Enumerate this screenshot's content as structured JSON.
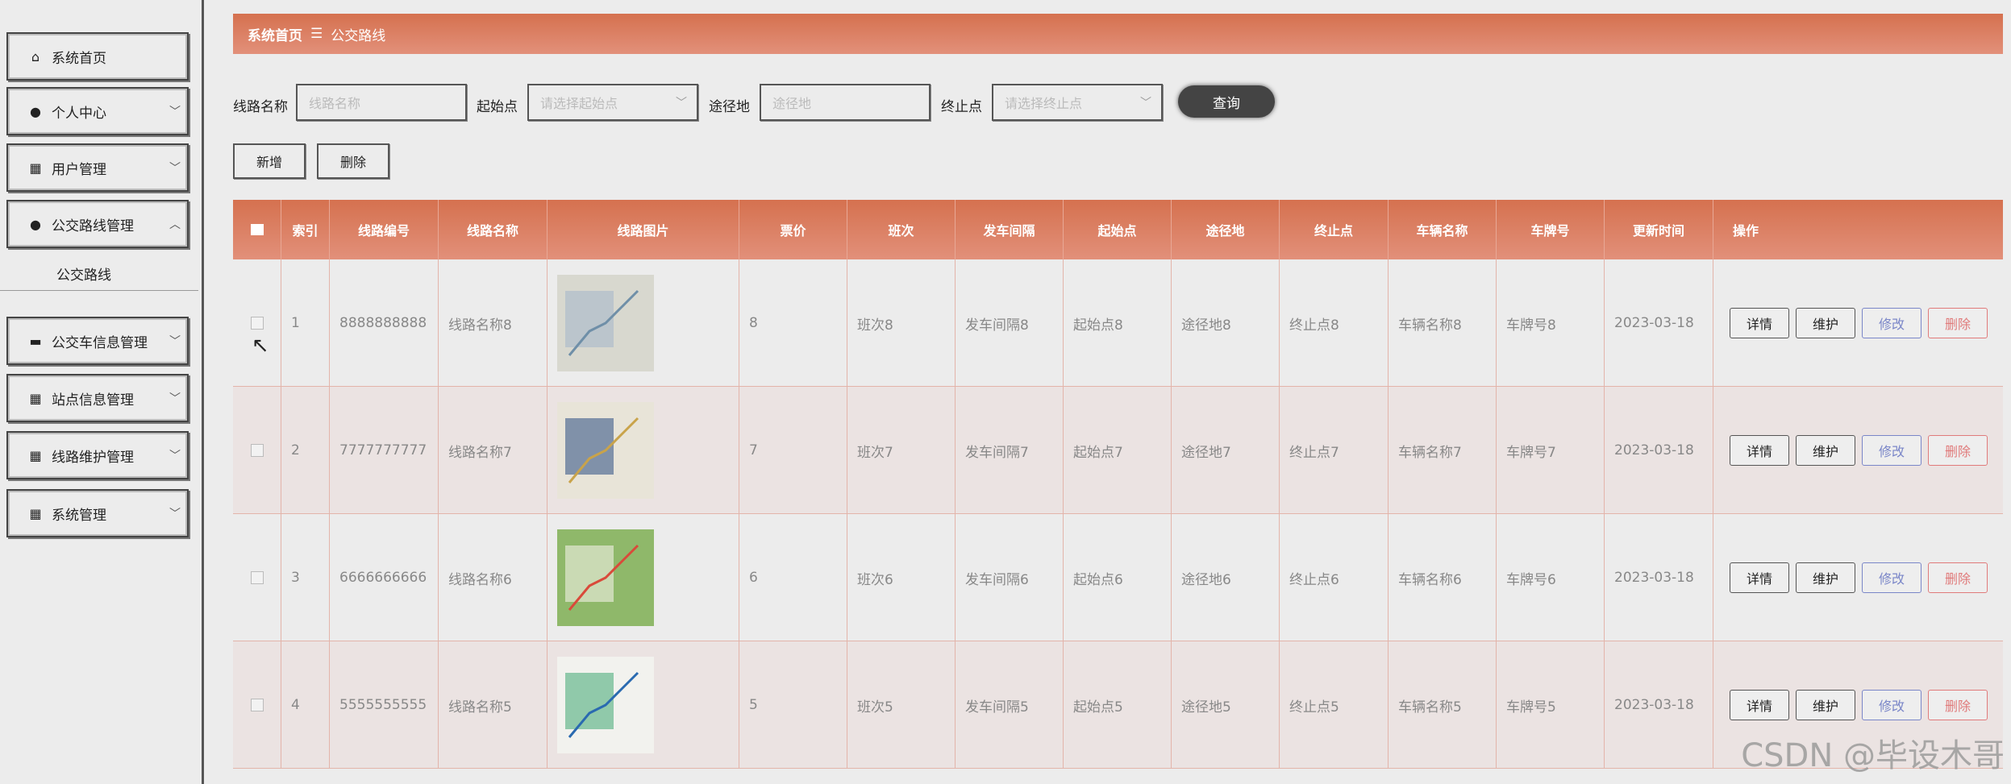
{
  "sidebar": {
    "items": [
      {
        "label": "系统首页",
        "icon": "home-icon",
        "caret": ""
      },
      {
        "label": "个人中心",
        "icon": "person-icon",
        "caret": "﹀"
      },
      {
        "label": "用户管理",
        "icon": "grid-icon",
        "caret": "﹀"
      },
      {
        "label": "公交路线管理",
        "icon": "person-icon",
        "caret": "︿"
      },
      {
        "label": "公交车信息管理",
        "icon": "message-icon",
        "caret": "﹀"
      },
      {
        "label": "站点信息管理",
        "icon": "grid-icon",
        "caret": "﹀"
      },
      {
        "label": "线路维护管理",
        "icon": "grid-icon",
        "caret": "﹀"
      },
      {
        "label": "系统管理",
        "icon": "grid-icon",
        "caret": "﹀"
      }
    ],
    "submenu_label": "公交路线"
  },
  "breadcrumb": {
    "home": "系统首页",
    "separator": "☰",
    "current": "公交路线"
  },
  "search": {
    "route_name_label": "线路名称",
    "route_name_placeholder": "线路名称",
    "start_label": "起始点",
    "start_placeholder": "请选择起始点",
    "via_label": "途径地",
    "via_placeholder": "途径地",
    "end_label": "终止点",
    "end_placeholder": "请选择终止点",
    "query_button": "查询"
  },
  "toolbar": {
    "add_label": "新增",
    "delete_label": "删除"
  },
  "table": {
    "headers": [
      "索引",
      "线路编号",
      "线路名称",
      "线路图片",
      "票价",
      "班次",
      "发车间隔",
      "起始点",
      "途径地",
      "终止点",
      "车辆名称",
      "车牌号",
      "更新时间",
      "操作"
    ],
    "rows": [
      {
        "index": "1",
        "code": "8888888888",
        "name": "线路名称8",
        "price": "8",
        "shift": "班次8",
        "interval": "发车间隔8",
        "start": "起始点8",
        "via": "途径地8",
        "end": "终止点8",
        "vehicle": "车辆名称8",
        "plate": "车牌号8",
        "updated": "2023-03-18"
      },
      {
        "index": "2",
        "code": "7777777777",
        "name": "线路名称7",
        "price": "7",
        "shift": "班次7",
        "interval": "发车间隔7",
        "start": "起始点7",
        "via": "途径地7",
        "end": "终止点7",
        "vehicle": "车辆名称7",
        "plate": "车牌号7",
        "updated": "2023-03-18"
      },
      {
        "index": "3",
        "code": "6666666666",
        "name": "线路名称6",
        "price": "6",
        "shift": "班次6",
        "interval": "发车间隔6",
        "start": "起始点6",
        "via": "途径地6",
        "end": "终止点6",
        "vehicle": "车辆名称6",
        "plate": "车牌号6",
        "updated": "2023-03-18"
      },
      {
        "index": "4",
        "code": "5555555555",
        "name": "线路名称5",
        "price": "5",
        "shift": "班次5",
        "interval": "发车间隔5",
        "start": "起始点5",
        "via": "途径地5",
        "end": "终止点5",
        "vehicle": "车辆名称5",
        "plate": "车牌号5",
        "updated": "2023-03-18"
      }
    ],
    "actions": {
      "detail": "详情",
      "maintain": "维护",
      "edit": "修改",
      "delete": "删除"
    }
  },
  "watermark": "CSDN @毕设木哥",
  "colors": {
    "accent": "#d5714f",
    "edit": "#7a86c8",
    "delete": "#e07b7b"
  }
}
